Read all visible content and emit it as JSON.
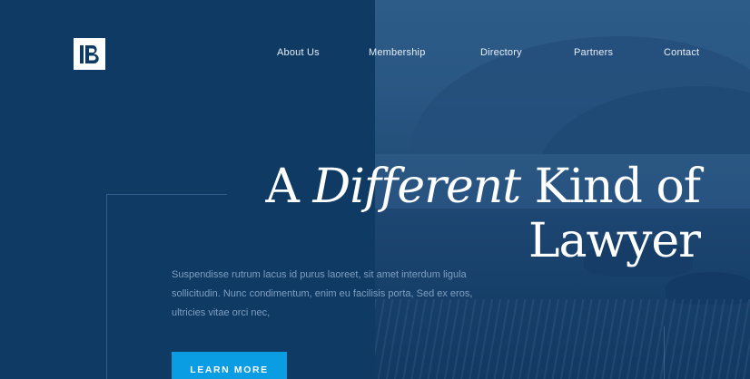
{
  "brand": {
    "logo_icon": "ib-monogram-icon",
    "logo_color": "#0e3a64"
  },
  "nav": {
    "items": [
      {
        "label": "About Us"
      },
      {
        "label": "Membership"
      },
      {
        "label": "Directory"
      },
      {
        "label": "Partners"
      },
      {
        "label": "Contact"
      }
    ]
  },
  "hero": {
    "headline_part1": "A ",
    "headline_emphasis": "Different",
    "headline_part2": " Kind of",
    "headline_line2": "Lawyer",
    "body": "Suspendisse rutrum lacus id purus laoreet, sit amet interdum ligula sollicitudin. Nunc condimentum, enim eu facilisis porta, Sed ex eros, ultricies vitae orci nec,",
    "cta_label": "LEARN MORE"
  },
  "colors": {
    "panel_navy": "#0e3a64",
    "accent_blue": "#0a9de3",
    "body_text": "#7f9fc0"
  }
}
